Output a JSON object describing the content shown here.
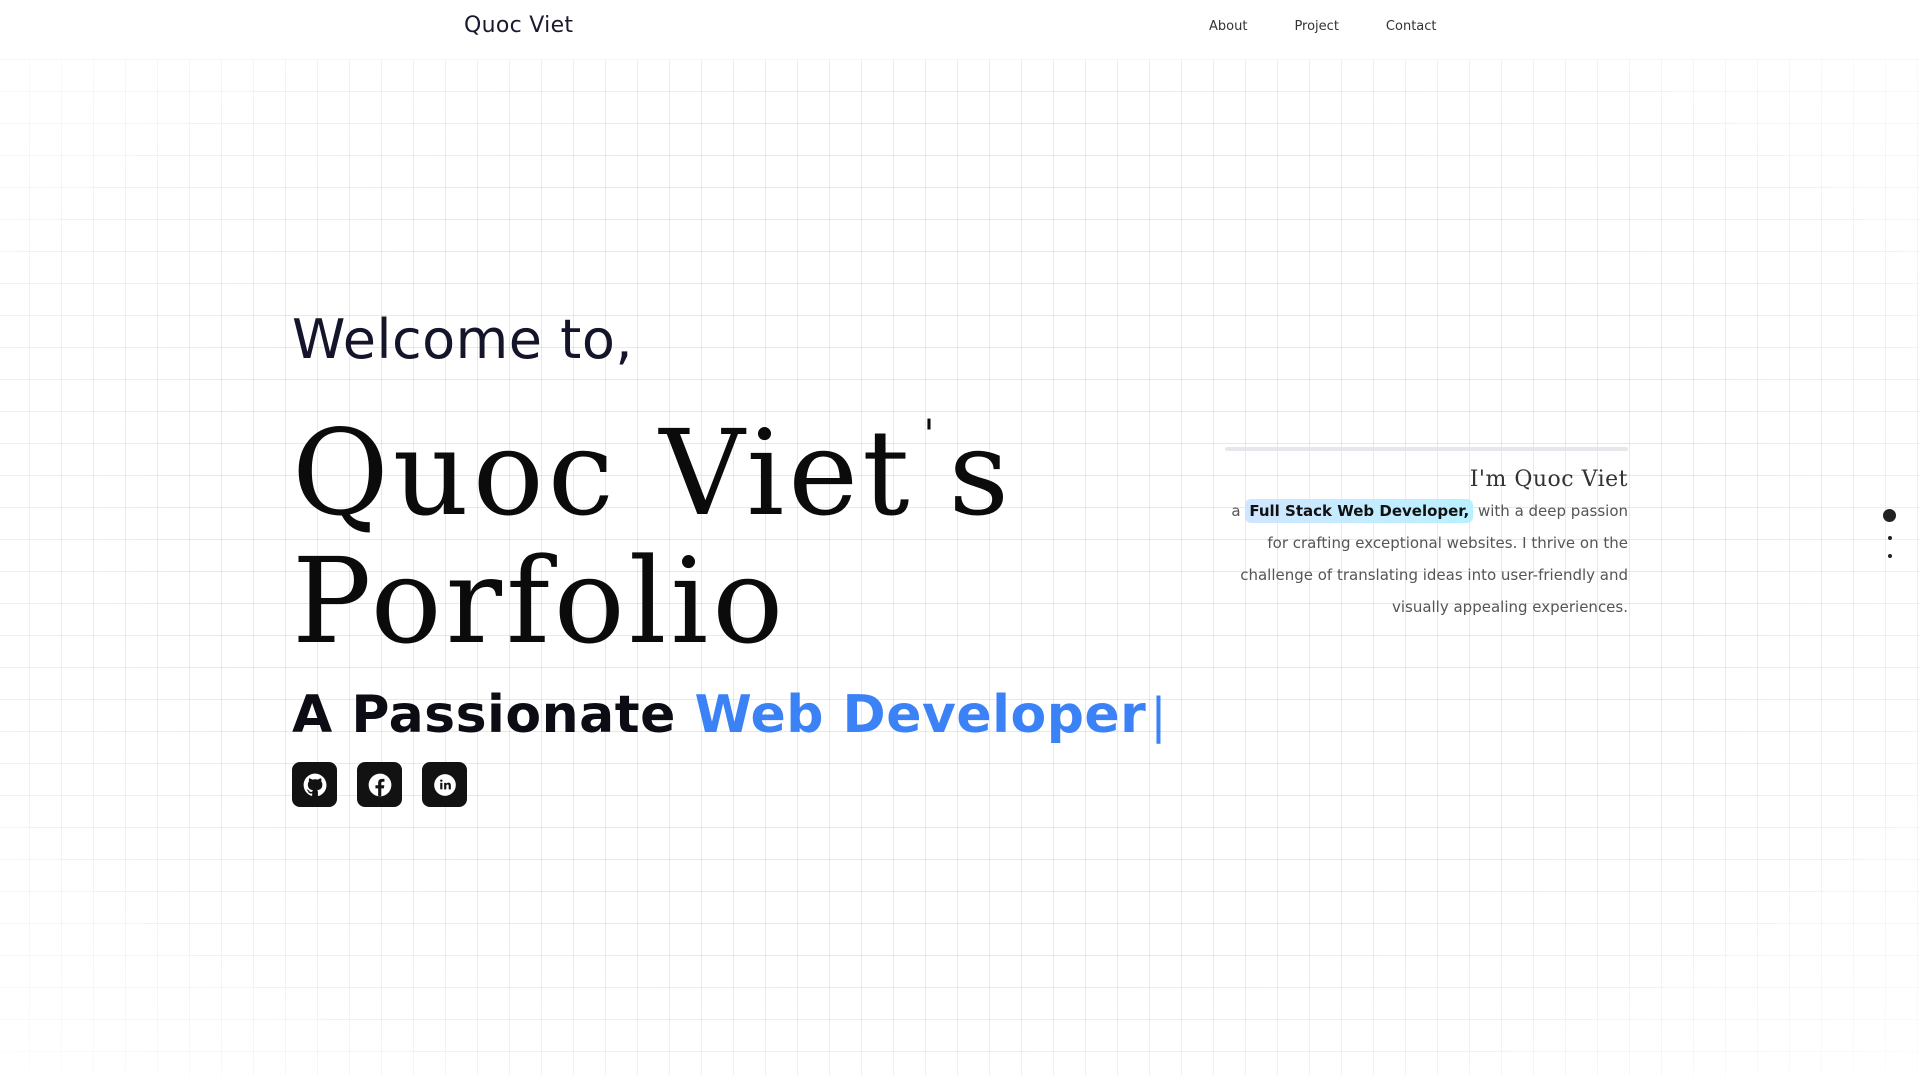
{
  "nav": {
    "brand": "Quoc Viet",
    "links": [
      "About",
      "Project",
      "Contact"
    ]
  },
  "hero": {
    "welcome": "Welcome to,",
    "title_name": "Quoc Viet",
    "title_apostrophe": "'",
    "title_suffix": "s",
    "title_line2": "Porfolio",
    "tagline_prefix": "A Passionate",
    "tagline_role": "Web Developer",
    "tagline_cursor": "|",
    "socials": [
      {
        "icon": "github-icon"
      },
      {
        "icon": "facebook-icon"
      },
      {
        "icon": "linkedin-icon"
      }
    ]
  },
  "intro": {
    "heading": "I'm Quoc Viet",
    "text_before": "a",
    "highlight": "Full Stack Web Developer,",
    "text_after": "with a deep passion for crafting exceptional websites. I thrive on the challenge of translating ideas into user-friendly and visually appealing experiences."
  },
  "section_dots": {
    "count": 3,
    "active_index": 0
  },
  "colors": {
    "accent": "#3b82f6",
    "icon_bg": "#121212",
    "highlight_start": "#cfe6ff",
    "highlight_end": "#b9f0ff"
  }
}
